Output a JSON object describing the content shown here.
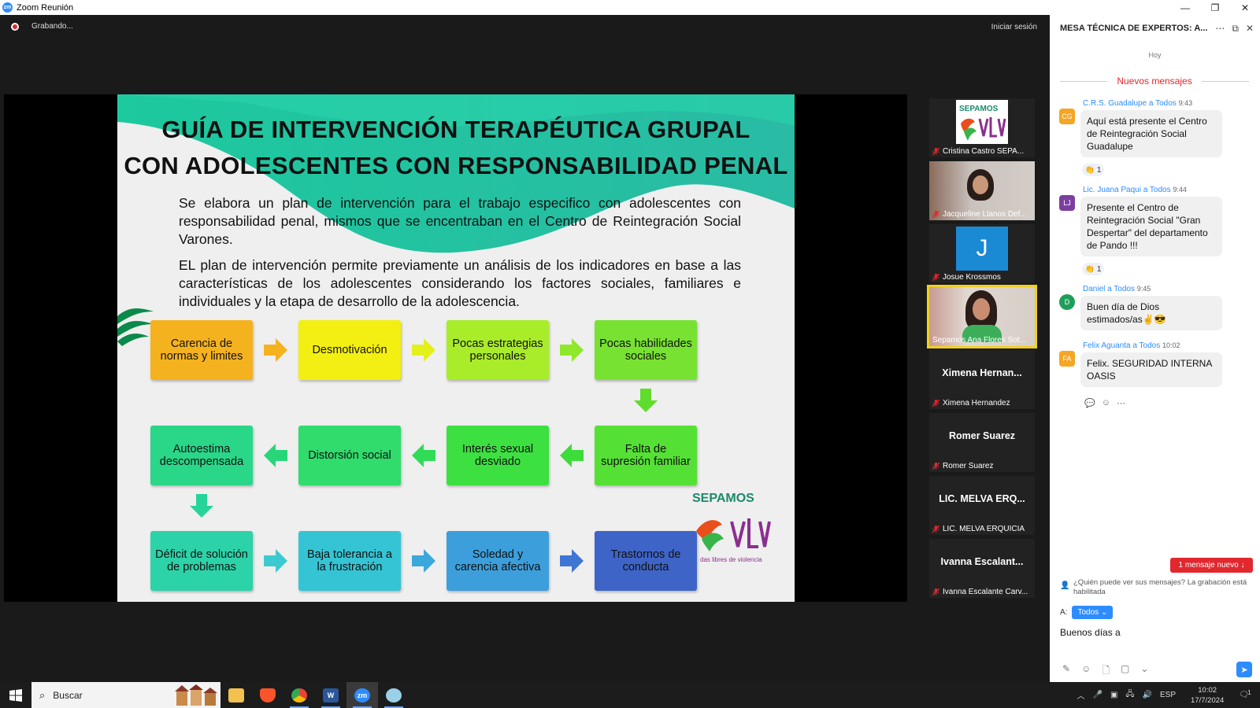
{
  "window": {
    "title": "Zoom Reunión",
    "minimize": "—",
    "restore": "❐",
    "close": "✕"
  },
  "topbar": {
    "recording": "Grabando...",
    "signin": "Iniciar sesión"
  },
  "slide": {
    "title_line1": "GUÍA DE INTERVENCIÓN TERAPÉUTICA GRUPAL",
    "title_line2": "CON ADOLESCENTES CON RESPONSABILIDAD PENAL",
    "para1": "Se elabora un plan de intervención para el trabajo especifico con adolescentes con responsabilidad penal, mismos que se encentraban en el Centro de Reintegración Social Varones.",
    "para2": "EL plan de intervención permite previamente un análisis de los indicadores en base a las características de los adolescentes considerando los factores sociales, familiares e individuales y la etapa de desarrollo de la adolescencia.",
    "boxes": [
      "Carencia de normas y limites",
      "Desmotivación",
      "Pocas estrategias personales",
      "Pocas habilidades sociales",
      "Falta de supresión familiar",
      "Interés sexual desviado",
      "Distorsión social",
      "Autoestima descompensada",
      "Déficit de solución de problemas",
      "Baja tolerancia a la frustración",
      "Soledad y carencia afectiva",
      "Trastornos de conducta"
    ],
    "logo_text": "SEPAMOS",
    "logo_sub": "das libres de violencia"
  },
  "participants": [
    {
      "name": "Cristina Castro SEPA...",
      "tile": "logo"
    },
    {
      "name": "Jacqueline Llanos Def...",
      "tile": "video"
    },
    {
      "name": "Josue Krossmos",
      "tile": "initial",
      "initial": "J"
    },
    {
      "name": "Sepamos Ana Flores Sot...",
      "tile": "video-active"
    },
    {
      "name": "Ximena Hernandez",
      "display": "Ximena  Hernan..."
    },
    {
      "name": "Romer Suarez",
      "display": "Romer Suarez"
    },
    {
      "name": "LIC. MELVA ERQUICIA",
      "display": "LIC. MELVA  ERQ..."
    },
    {
      "name": "Ivanna Escalante Carv...",
      "display": "Ivanna  Escalant..."
    }
  ],
  "chat": {
    "header": "MESA TÉCNICA DE EXPERTOS: A...",
    "today": "Hoy",
    "new_messages": "Nuevos mensajes",
    "messages": [
      {
        "initials": "CG",
        "color": "#f5a623",
        "sender": "C.R.S. Guadalupe a Todos",
        "time": "9:43",
        "text": "Aquí está presente el Centro de Reintegración Social Guadalupe",
        "reaction": "👏 1"
      },
      {
        "initials": "LJ",
        "color": "#7b3fa0",
        "sender": "Lic. Juana Paqui a Todos",
        "time": "9:44",
        "text": "Presente el Centro de Reintegración Social \"Gran Despertar\" del departamento de Pando !!!",
        "reaction": "👏 1"
      },
      {
        "initials": "D",
        "color": "#1e9e5a",
        "sender": "Daniel a Todos",
        "time": "9:45",
        "text": "Buen día de Dios estimados/as✌️😎"
      },
      {
        "initials": "FA",
        "color": "#f5a623",
        "sender": "Felix Aguanta a Todos",
        "time": "10:02",
        "text": "Felix. SEGURIDAD INTERNA OASIS"
      }
    ],
    "new_badge": "1 mensaje nuevo ↓",
    "who_can_see": "¿Quién puede ver sus mensajes? La grabación está habilitada",
    "to_label": "A:",
    "to_value": "Todos ⌄",
    "compose_text": "Buenos días a"
  },
  "taskbar": {
    "search": "Buscar",
    "language": "ESP",
    "time": "10:02",
    "date": "17/7/2024",
    "notifications": "1"
  }
}
